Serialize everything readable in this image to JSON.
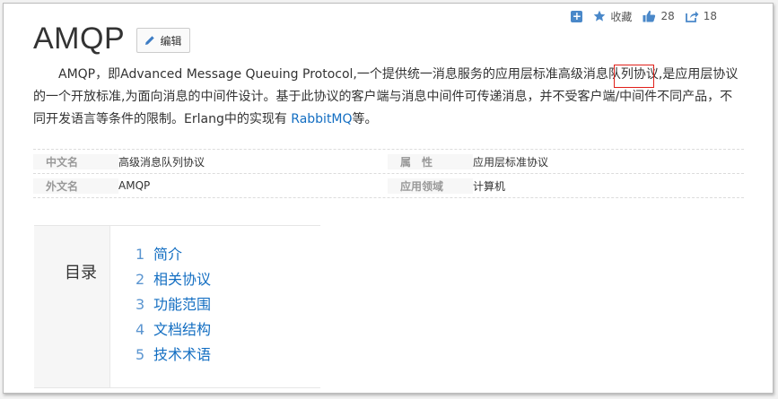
{
  "toolbar": {
    "collect_label": "收藏",
    "like_count": "28",
    "share_count": "18"
  },
  "title": "AMQP",
  "edit_label": "编辑",
  "intro": {
    "part1": "AMQP，即Advanced Message Queuing Protocol,一个提供统一消息服务的应用层标准高级消息队列协议,是应用层协议的一个开放标准,为面向消息的中间件设计。基于此协议的客户端与消息中间件可传递消息，并不受客户端/中间件不同产品，不同开发语言等条件的限制。Erlang中的实现有 ",
    "link": "RabbitMQ",
    "part2": "等。"
  },
  "info": {
    "rows": [
      {
        "k1": "中文名",
        "v1": "高级消息队列协议",
        "k2": "属　性",
        "v2": "应用层标准协议"
      },
      {
        "k1": "外文名",
        "v1": "AMQP",
        "k2": "应用领域",
        "v2": "计算机"
      }
    ]
  },
  "toc": {
    "heading": "目录",
    "items": [
      {
        "num": "1",
        "label": "简介"
      },
      {
        "num": "2",
        "label": "相关协议"
      },
      {
        "num": "3",
        "label": "功能范围"
      },
      {
        "num": "4",
        "label": "文档结构"
      },
      {
        "num": "5",
        "label": "技术术语"
      }
    ]
  },
  "colors": {
    "link": "#136ec2",
    "highlight_box": "#e0201a",
    "accent": "#4a88c9"
  }
}
